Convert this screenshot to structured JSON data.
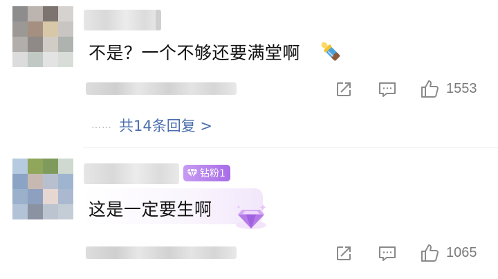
{
  "comments": [
    {
      "text": "不是？一个不够还要满堂啊",
      "emoji_icon": "baby-bottle-sticker-icon",
      "like_count": "1553",
      "reply_link": "共14条回复 >",
      "reply_dots": "……"
    },
    {
      "text": "这是一定要生啊",
      "badge_label": "钻粉1",
      "badge_icon": "diamond-icon",
      "sticker_icon": "purple-diamond-sticker-icon",
      "like_count": "1065"
    }
  ],
  "colors": {
    "reply_link": "#4b6fae",
    "badge_start": "#c79bf2",
    "badge_end": "#a86ce8",
    "action_icon": "#8a8a8a"
  }
}
